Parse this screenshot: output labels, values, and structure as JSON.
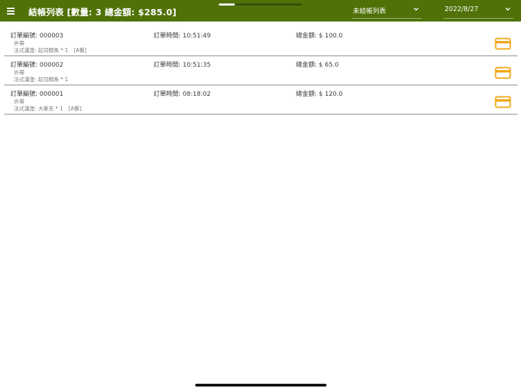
{
  "header": {
    "title": "結帳列表 [數量: 3   總金額: $285.0]",
    "menu_icon": "menu-icon",
    "status_filter": {
      "selected": "未結帳列表",
      "icon": "chevron-down-icon"
    },
    "date_filter": {
      "selected": "2022/8/27",
      "icon": "chevron-down-icon"
    }
  },
  "colors": {
    "appbar": "#4f7108",
    "accent_pay_icon": "#f0a81a",
    "divider": "#8a8a8a"
  },
  "orders": [
    {
      "order_no": "訂單編號: 000003",
      "order_time": "訂單時間: 10:51:49",
      "total": "總金額: $ 100.0",
      "type": "外帶",
      "items": "法式漢堡: 起司鱈魚 * 1",
      "tag": "[A餐]",
      "pay_icon": "credit-card-icon"
    },
    {
      "order_no": "訂單編號: 000002",
      "order_time": "訂單時間: 10:51:35",
      "total": "總金額: $ 65.0",
      "type": "外帶",
      "items": "法式漢堡: 起司鱈魚 * 1",
      "tag": "",
      "pay_icon": "credit-card-icon"
    },
    {
      "order_no": "訂單編號: 000001",
      "order_time": "訂單時間: 08:18:02",
      "total": "總金額: $ 120.0",
      "type": "外帶",
      "items": "法式漢堡: 大麥克 * 1",
      "tag": "[A餐]",
      "pay_icon": "credit-card-icon"
    }
  ]
}
